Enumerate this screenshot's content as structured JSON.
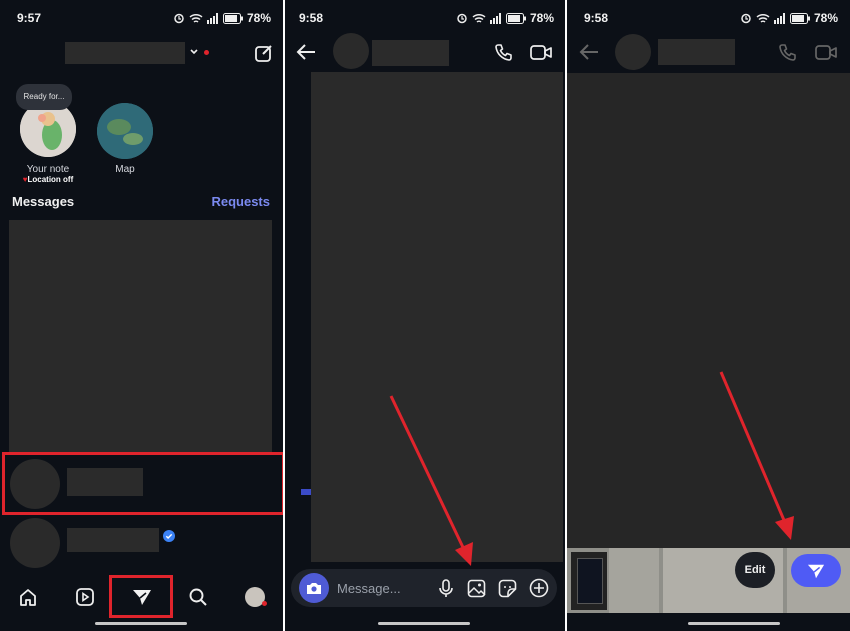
{
  "colors": {
    "background": "#0c1017",
    "accent": "#4f5bf5",
    "link": "#7b8af0",
    "highlight": "#e0242c",
    "redacted": "#2b2b2b"
  },
  "panel1": {
    "status": {
      "time": "9:57",
      "battery": "78%"
    },
    "note_bubble": "Ready for...",
    "stories": [
      {
        "label": "Your note",
        "sublabel": "Location off"
      },
      {
        "label": "Map"
      }
    ],
    "messages_heading": "Messages",
    "requests_link": "Requests",
    "nav": [
      "home-icon",
      "reels-icon",
      "direct-icon",
      "search-icon",
      "profile-avatar"
    ]
  },
  "panel2": {
    "status": {
      "time": "9:58",
      "battery": "78%"
    },
    "message_placeholder": "Message...",
    "composer_icons": [
      "camera-icon",
      "microphone-icon",
      "gallery-icon",
      "sticker-icon",
      "plus-icon"
    ]
  },
  "panel3": {
    "status": {
      "time": "9:58",
      "battery": "78%"
    },
    "edit_label": "Edit"
  }
}
